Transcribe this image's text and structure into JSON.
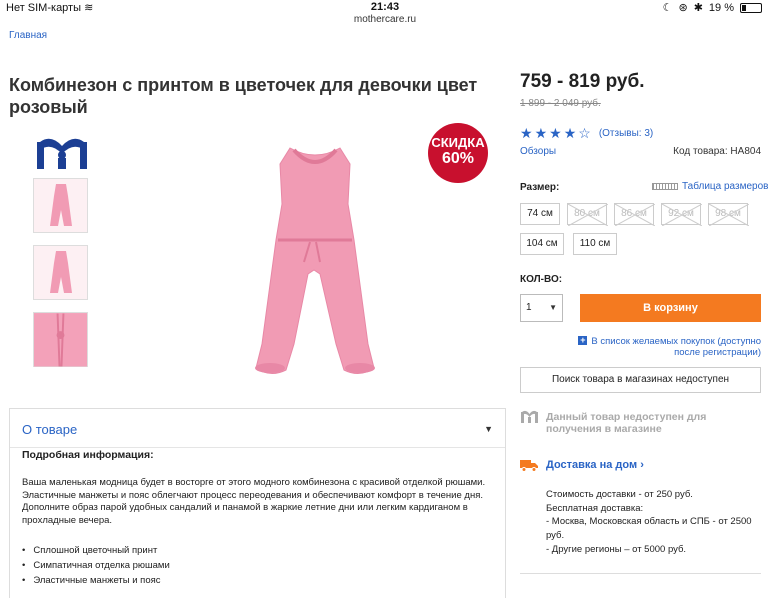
{
  "status": {
    "carrier": "Нет SIM-карты",
    "time": "21:43",
    "battery": "19 %"
  },
  "url": "mothercare.ru",
  "breadcrumb": "Главная",
  "product": {
    "title": "Комбинезон с принтом в цветочек для девочки цвет розовый",
    "badge_line1": "СКИДКА",
    "badge_line2": "60%",
    "price": "759 - 819 руб.",
    "old_price": "1 899 - 2 049 руб.",
    "rating": 4,
    "reviews": "(Отзывы: 3)",
    "reviews_link": "Обзоры",
    "code": "Код товара: HA804"
  },
  "size": {
    "label": "Размер:",
    "table_link": "Таблица размеров",
    "options": [
      {
        "label": "74 см",
        "available": true
      },
      {
        "label": "80 см",
        "available": false
      },
      {
        "label": "86 см",
        "available": false
      },
      {
        "label": "92 см",
        "available": false
      },
      {
        "label": "98 см",
        "available": false
      },
      {
        "label": "104 см",
        "available": true
      },
      {
        "label": "110 см",
        "available": true
      }
    ]
  },
  "qty": {
    "label": "КОЛ-ВО:",
    "value": "1"
  },
  "actions": {
    "cart": "В корзину",
    "wishlist": "В список желаемых покупок (доступно после регистрации)",
    "store_search": "Поиск товара в магазинах недоступен"
  },
  "about": {
    "heading": "О товаре",
    "subheading": "Подробная информация:",
    "description": "Ваша маленькая модница будет в восторге от этого модного комбинезона с красивой отделкой рюшами. Эластичные манжеты и пояс облегчают процесс переодевания и обеспечивают комфорт в течение дня. Дополните образ парой удобных сандалий и панамой в жаркие летние дни или легким кардиганом в прохладные вечера.",
    "bullets": [
      "Сплошной цветочный принт",
      "Симпатичная отделка рюшами",
      "Эластичные манжеты и пояс"
    ]
  },
  "store": {
    "unavailable": "Данный товар недоступен для получения в магазине"
  },
  "delivery": {
    "heading": "Доставка на дом",
    "lines": [
      "Стоимость доставки - от 250 руб.",
      "Бесплатная доставка:",
      "- Москва, Московская область и СПБ - от 2500 руб.",
      "- Другие регионы – от 5000 руб."
    ]
  },
  "colors": {
    "accent": "#2a64c5",
    "cta": "#f47a20",
    "badge": "#c8102e",
    "garment": "#f19bb4"
  }
}
